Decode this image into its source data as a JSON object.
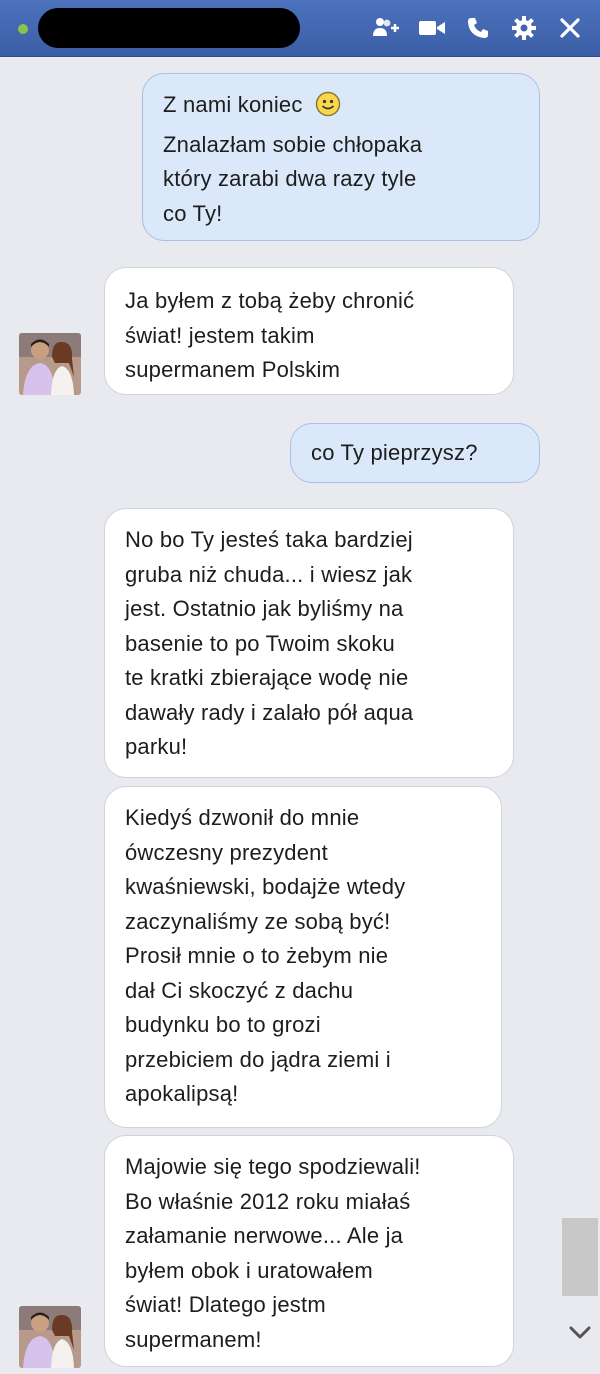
{
  "header": {
    "contact_name": "██████████",
    "icons": [
      "add-friend-icon",
      "video-call-icon",
      "phone-icon",
      "gear-icon",
      "close-icon"
    ]
  },
  "messages": [
    {
      "direction": "outgoing",
      "lines": [
        "Z nami koniec",
        "Znalazłam sobie chłopaka",
        "który zarabi dwa razy tyle",
        "co Ty!"
      ],
      "emoji": "smiley-icon"
    },
    {
      "direction": "incoming",
      "lines": [
        "Ja byłem z tobą żeby chronić",
        "świat! jestem takim",
        "supermanem Polskim"
      ]
    },
    {
      "direction": "outgoing",
      "lines": [
        "co Ty pieprzysz?"
      ]
    },
    {
      "direction": "incoming",
      "lines": [
        "No bo Ty jesteś taka bardziej",
        "gruba niż chuda... i wiesz jak",
        "jest. Ostatnio jak byliśmy na",
        "basenie to po Twoim skoku",
        "te kratki zbierające wodę nie",
        "dawały rady i zalało pół aqua",
        "parku!"
      ]
    },
    {
      "direction": "incoming",
      "lines": [
        "Kiedyś dzwonił do mnie",
        "ówczesny prezydent",
        "kwaśniewski, bodajże wtedy",
        "zaczynaliśmy ze sobą być!",
        "Prosił mnie o to żebym nie",
        "dał Ci skoczyć z dachu",
        "budynku bo to grozi",
        "przebiciem do jądra ziemi i",
        "apokalipsą!"
      ]
    },
    {
      "direction": "incoming",
      "lines": [
        "Majowie się tego spodziewali!",
        "Bo właśnie 2012 roku miałaś",
        "załamanie nerwowe... Ale ja",
        "byłem obok i uratowałem",
        "świat! Dlatego jestm",
        "supermanem!"
      ]
    }
  ]
}
